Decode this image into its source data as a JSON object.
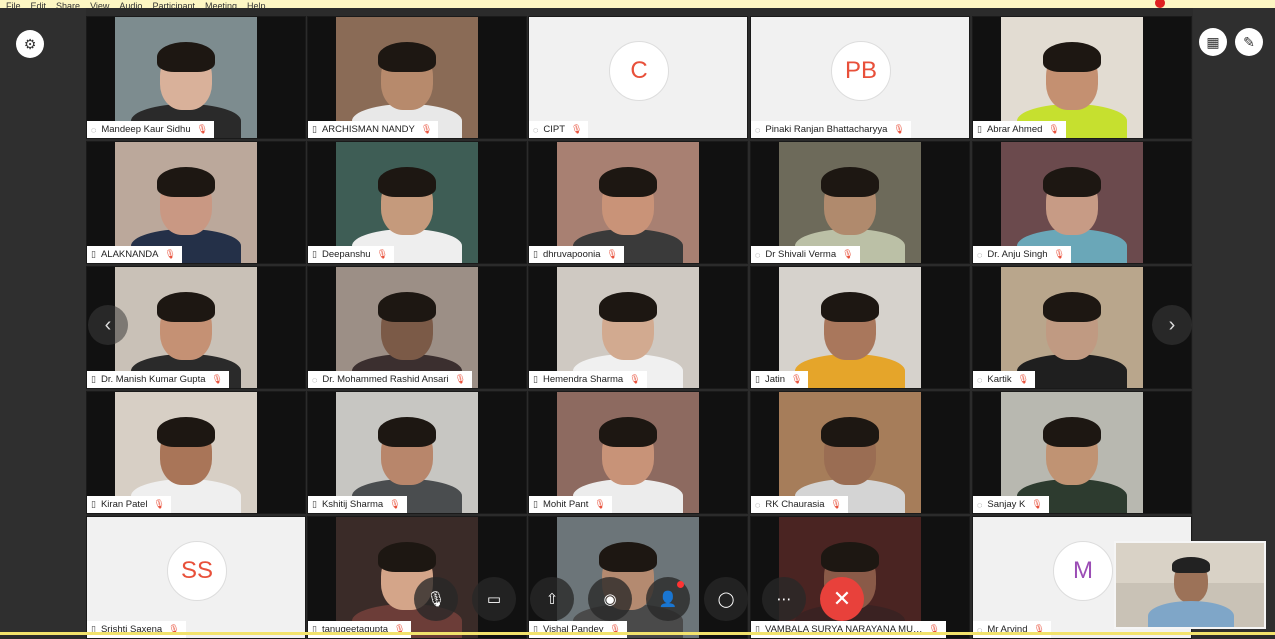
{
  "menubar": {
    "items": [
      "File",
      "Edit",
      "Share",
      "View",
      "Audio",
      "Participant",
      "Meeting",
      "Help"
    ],
    "indicator_color": "#e02020"
  },
  "left_sidebar": {
    "icon": "gear-icon"
  },
  "right_sidebar": {
    "icons": [
      "grid-view-icon",
      "pin-icon"
    ]
  },
  "participants": [
    {
      "name": "Mandeep Kaur Sidhu",
      "type": "video",
      "bg": "#7d8c8f",
      "skin": "#d9b19a",
      "shirt": "#2a2a2a",
      "tag_icon": "◌"
    },
    {
      "name": "ARCHISMAN NANDY",
      "type": "video",
      "bg": "#8a6b56",
      "skin": "#b78a6c",
      "shirt": "#e8e8e8",
      "tag_icon": "▯"
    },
    {
      "name": "CIPT",
      "type": "initials",
      "initials": "C",
      "tag_icon": "◌"
    },
    {
      "name": "Pinaki Ranjan Bhattacharyya",
      "type": "initials",
      "initials": "PB",
      "tag_icon": "◌"
    },
    {
      "name": "Abrar Ahmed",
      "type": "video",
      "bg": "#e2dcd2",
      "skin": "#c49071",
      "shirt": "#c6e02f",
      "tag_icon": "▯"
    },
    {
      "name": "ALAKNANDA",
      "type": "video",
      "bg": "#bba89b",
      "skin": "#c99883",
      "shirt": "#243048",
      "tag_icon": "▯"
    },
    {
      "name": "Deepanshu",
      "type": "video",
      "bg": "#3e5d55",
      "skin": "#c59a7c",
      "shirt": "#eeeeee",
      "tag_icon": "▯"
    },
    {
      "name": "dhruvapoonia",
      "type": "video",
      "bg": "#a88072",
      "skin": "#c99378",
      "shirt": "#3a3a3a",
      "tag_icon": "▯"
    },
    {
      "name": "Dr Shivali Verma",
      "type": "video",
      "bg": "#6d6a5a",
      "skin": "#b08a6d",
      "shirt": "#bbc0a6",
      "tag_icon": "◌"
    },
    {
      "name": "Dr. Anju Singh",
      "type": "video",
      "bg": "#6b4a4d",
      "skin": "#c79b85",
      "shirt": "#6aa7b8",
      "tag_icon": "◌"
    },
    {
      "name": "Dr. Manish Kumar Gupta",
      "type": "video",
      "bg": "#c9c1b7",
      "skin": "#c59174",
      "shirt": "#2a2a2a",
      "tag_icon": "▯"
    },
    {
      "name": "Dr. Mohammed Rashid Ansari",
      "type": "video",
      "bg": "#9c8f86",
      "skin": "#7b5a47",
      "shirt": "#3b2f2f",
      "tag_icon": "◌"
    },
    {
      "name": "Hemendra Sharma",
      "type": "video",
      "bg": "#cfc9c2",
      "skin": "#d2aa90",
      "shirt": "#f0f0f0",
      "tag_icon": "▯"
    },
    {
      "name": "Jatin",
      "type": "video",
      "bg": "#d6d2cc",
      "skin": "#a9775c",
      "shirt": "#e5a52a",
      "tag_icon": "▯"
    },
    {
      "name": "Kartik",
      "type": "video",
      "bg": "#b9a68c",
      "skin": "#c09a82",
      "shirt": "#1f1f1f",
      "tag_icon": "◌"
    },
    {
      "name": "Kiran Patel",
      "type": "video",
      "bg": "#d7cfc5",
      "skin": "#a97558",
      "shirt": "#efefef",
      "tag_icon": "▯"
    },
    {
      "name": "Kshitij Sharma",
      "type": "video",
      "bg": "#c7c6c2",
      "skin": "#b8866b",
      "shirt": "#4a4d4f",
      "tag_icon": "▯"
    },
    {
      "name": "Mohit Pant",
      "type": "video",
      "bg": "#8d6a60",
      "skin": "#c89378",
      "shirt": "#ececec",
      "tag_icon": "▯"
    },
    {
      "name": "RK Chaurasia",
      "type": "video",
      "bg": "#a67d5a",
      "skin": "#9a6d53",
      "shirt": "#d4d4d4",
      "tag_icon": "◌"
    },
    {
      "name": "Sanjay K",
      "type": "video",
      "bg": "#b8b8b0",
      "skin": "#c09373",
      "shirt": "#2d3b2f",
      "tag_icon": "◌"
    },
    {
      "name": "Srishti Saxena",
      "type": "initials",
      "initials": "SS",
      "tag_icon": "▯"
    },
    {
      "name": "tanugeetagupta",
      "type": "video",
      "bg": "#3a2b28",
      "skin": "#d4a589",
      "shirt": "#6c3d38",
      "tag_icon": "▯"
    },
    {
      "name": "Vishal Pandey",
      "type": "video",
      "bg": "#6c7579",
      "skin": "#b48a70",
      "shirt": "#4a4a4a",
      "tag_icon": "▯"
    },
    {
      "name": "VAMBALA SURYA NARAYANA MU…",
      "type": "video",
      "bg": "#4a2422",
      "skin": "#8a5a48",
      "shirt": "#3a2222",
      "tag_icon": "▯"
    },
    {
      "name": "Mr Arvind",
      "type": "initials",
      "initials": "M",
      "color": "purple",
      "tag_icon": "◌"
    }
  ],
  "controls": [
    {
      "name": "mute-button",
      "glyph": "🎙"
    },
    {
      "name": "video-button",
      "glyph": "▭"
    },
    {
      "name": "share-button",
      "glyph": "⇧"
    },
    {
      "name": "record-button",
      "glyph": "◉"
    },
    {
      "name": "participants-button",
      "glyph": "👤"
    },
    {
      "name": "chat-button",
      "glyph": "◯"
    },
    {
      "name": "more-button",
      "glyph": "⋯"
    },
    {
      "name": "end-call-button",
      "glyph": "✕"
    }
  ],
  "nav": {
    "prev_glyph": "‹",
    "next_glyph": "›"
  }
}
